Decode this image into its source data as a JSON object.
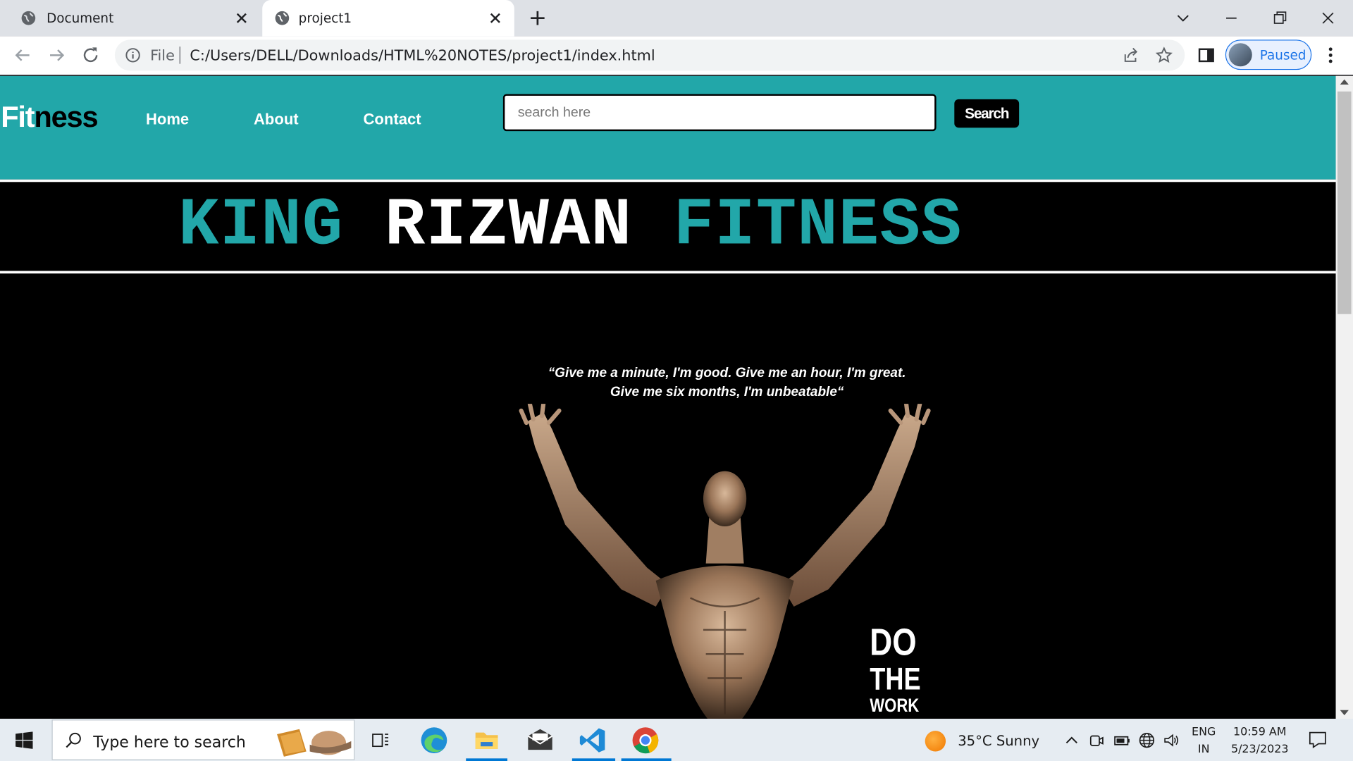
{
  "browser": {
    "tabs": [
      {
        "title": "Document"
      },
      {
        "title": "project1"
      }
    ],
    "address": {
      "scheme_label": "File",
      "url": "C:/Users/DELL/Downloads/HTML%20NOTES/project1/index.html"
    },
    "profile_label": "Paused"
  },
  "page": {
    "logo": {
      "part1": "Fit",
      "part2": "ness"
    },
    "nav": [
      {
        "label": "Home"
      },
      {
        "label": "About"
      },
      {
        "label": "Contact"
      }
    ],
    "search": {
      "placeholder": "search here",
      "button_label": "Search"
    },
    "banner": {
      "word1": "KING",
      "word2": "RIZWAN",
      "word3": "FITNESS"
    },
    "hero": {
      "quote": "“Give me a minute, I'm good. Give me an hour, I'm great. Give me six months, I'm unbeatable“",
      "slogan": {
        "line1": "DO",
        "line2": "THE",
        "line3": "WORK"
      }
    },
    "colors": {
      "teal": "#22a7a9",
      "black": "#000000",
      "white": "#ffffff"
    }
  },
  "taskbar": {
    "search_placeholder": "Type here to search",
    "weather": "35°C  Sunny",
    "language": {
      "line1": "ENG",
      "line2": "IN"
    },
    "clock": {
      "time": "10:59 AM",
      "date": "5/23/2023"
    },
    "pinned_icons": [
      "task-view-icon",
      "edge-icon",
      "file-explorer-icon",
      "mail-icon",
      "vscode-icon",
      "chrome-icon"
    ]
  }
}
